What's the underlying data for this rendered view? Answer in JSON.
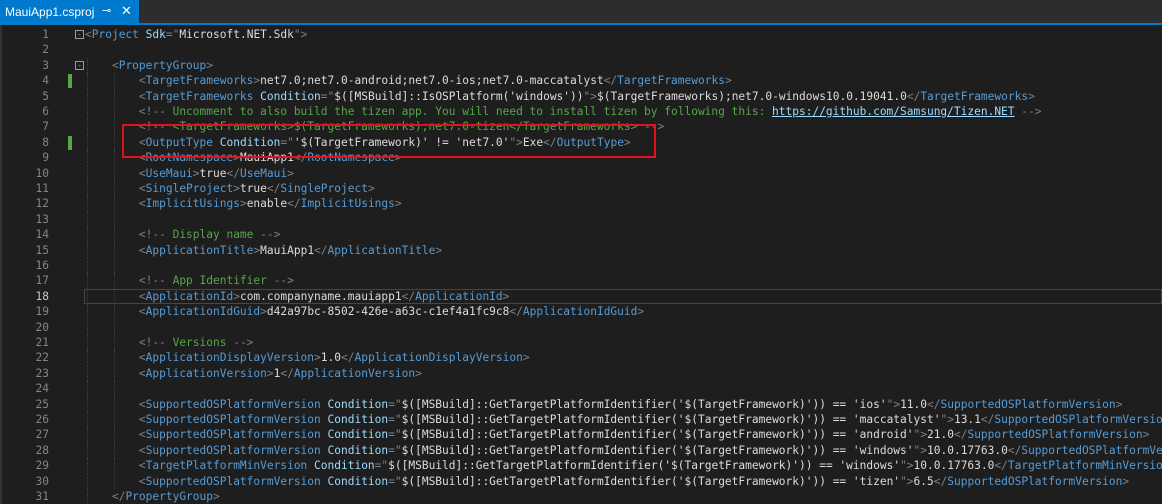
{
  "tab": {
    "title": "MauiApp1.csproj",
    "pin_icon": "⊸",
    "close_icon": "✕"
  },
  "lines": [
    {
      "n": "1",
      "fold": "-",
      "tokens": [
        {
          "t": "d",
          "s": "<"
        },
        {
          "t": "e",
          "s": "Project"
        },
        {
          "t": "x",
          "s": " "
        },
        {
          "t": "a",
          "s": "Sdk"
        },
        {
          "t": "d",
          "s": "=\""
        },
        {
          "t": "v",
          "s": "Microsoft.NET.Sdk"
        },
        {
          "t": "d",
          "s": "\">"
        }
      ]
    },
    {
      "n": "2",
      "tokens": []
    },
    {
      "n": "3",
      "fold": "-",
      "tokens": [
        {
          "t": "x",
          "s": "    "
        },
        {
          "t": "d",
          "s": "<"
        },
        {
          "t": "e",
          "s": "PropertyGroup"
        },
        {
          "t": "d",
          "s": ">"
        }
      ]
    },
    {
      "n": "4",
      "chg": true,
      "tokens": [
        {
          "t": "x",
          "s": "        "
        },
        {
          "t": "d",
          "s": "<"
        },
        {
          "t": "e",
          "s": "TargetFrameworks"
        },
        {
          "t": "d",
          "s": ">"
        },
        {
          "t": "t",
          "s": "net7.0;net7.0-android;net7.0-ios;net7.0-maccatalyst"
        },
        {
          "t": "d",
          "s": "</"
        },
        {
          "t": "e",
          "s": "TargetFrameworks"
        },
        {
          "t": "d",
          "s": ">"
        }
      ]
    },
    {
      "n": "5",
      "tokens": [
        {
          "t": "x",
          "s": "        "
        },
        {
          "t": "d",
          "s": "<"
        },
        {
          "t": "e",
          "s": "TargetFrameworks"
        },
        {
          "t": "x",
          "s": " "
        },
        {
          "t": "a",
          "s": "Condition"
        },
        {
          "t": "d",
          "s": "=\""
        },
        {
          "t": "v",
          "s": "$([MSBuild]::IsOSPlatform('windows'))"
        },
        {
          "t": "d",
          "s": "\">"
        },
        {
          "t": "t",
          "s": "$(TargetFrameworks);net7.0-windows10.0.19041.0"
        },
        {
          "t": "d",
          "s": "</"
        },
        {
          "t": "e",
          "s": "TargetFrameworks"
        },
        {
          "t": "d",
          "s": ">"
        }
      ]
    },
    {
      "n": "6",
      "tokens": [
        {
          "t": "x",
          "s": "        "
        },
        {
          "t": "d",
          "s": "<!--"
        },
        {
          "t": "c",
          "s": " Uncomment to also build the tizen app. You will need to install tizen by following this: "
        },
        {
          "t": "l",
          "s": "https://github.com/Samsung/Tizen.NET"
        },
        {
          "t": "c",
          "s": " "
        },
        {
          "t": "d",
          "s": "-->"
        }
      ]
    },
    {
      "n": "7",
      "tokens": [
        {
          "t": "x",
          "s": "        "
        },
        {
          "t": "d",
          "s": "<!--"
        },
        {
          "t": "c",
          "s": " <TargetFrameworks>$(TargetFrameworks);net7.0-tizen</TargetFrameworks> "
        },
        {
          "t": "d",
          "s": "-->"
        }
      ]
    },
    {
      "n": "8",
      "chg": true,
      "tokens": [
        {
          "t": "x",
          "s": "        "
        },
        {
          "t": "d",
          "s": "<"
        },
        {
          "t": "e",
          "s": "OutputType"
        },
        {
          "t": "x",
          "s": " "
        },
        {
          "t": "a",
          "s": "Condition"
        },
        {
          "t": "d",
          "s": "=\""
        },
        {
          "t": "v",
          "s": "'$(TargetFramework)' != 'net7.0'"
        },
        {
          "t": "d",
          "s": "\">"
        },
        {
          "t": "t",
          "s": "Exe"
        },
        {
          "t": "d",
          "s": "</"
        },
        {
          "t": "e",
          "s": "OutputType"
        },
        {
          "t": "d",
          "s": ">"
        }
      ]
    },
    {
      "n": "9",
      "tokens": [
        {
          "t": "x",
          "s": "        "
        },
        {
          "t": "d",
          "s": "<"
        },
        {
          "t": "e",
          "s": "RootNamespace"
        },
        {
          "t": "d",
          "s": ">"
        },
        {
          "t": "t",
          "s": "MauiApp1"
        },
        {
          "t": "d",
          "s": "</"
        },
        {
          "t": "e",
          "s": "RootNamespace"
        },
        {
          "t": "d",
          "s": ">"
        }
      ]
    },
    {
      "n": "10",
      "tokens": [
        {
          "t": "x",
          "s": "        "
        },
        {
          "t": "d",
          "s": "<"
        },
        {
          "t": "e",
          "s": "UseMaui"
        },
        {
          "t": "d",
          "s": ">"
        },
        {
          "t": "t",
          "s": "true"
        },
        {
          "t": "d",
          "s": "</"
        },
        {
          "t": "e",
          "s": "UseMaui"
        },
        {
          "t": "d",
          "s": ">"
        }
      ]
    },
    {
      "n": "11",
      "tokens": [
        {
          "t": "x",
          "s": "        "
        },
        {
          "t": "d",
          "s": "<"
        },
        {
          "t": "e",
          "s": "SingleProject"
        },
        {
          "t": "d",
          "s": ">"
        },
        {
          "t": "t",
          "s": "true"
        },
        {
          "t": "d",
          "s": "</"
        },
        {
          "t": "e",
          "s": "SingleProject"
        },
        {
          "t": "d",
          "s": ">"
        }
      ]
    },
    {
      "n": "12",
      "tokens": [
        {
          "t": "x",
          "s": "        "
        },
        {
          "t": "d",
          "s": "<"
        },
        {
          "t": "e",
          "s": "ImplicitUsings"
        },
        {
          "t": "d",
          "s": ">"
        },
        {
          "t": "t",
          "s": "enable"
        },
        {
          "t": "d",
          "s": "</"
        },
        {
          "t": "e",
          "s": "ImplicitUsings"
        },
        {
          "t": "d",
          "s": ">"
        }
      ]
    },
    {
      "n": "13",
      "tokens": []
    },
    {
      "n": "14",
      "tokens": [
        {
          "t": "x",
          "s": "        "
        },
        {
          "t": "d",
          "s": "<!--"
        },
        {
          "t": "c",
          "s": " Display name "
        },
        {
          "t": "d",
          "s": "-->"
        }
      ]
    },
    {
      "n": "15",
      "tokens": [
        {
          "t": "x",
          "s": "        "
        },
        {
          "t": "d",
          "s": "<"
        },
        {
          "t": "e",
          "s": "ApplicationTitle"
        },
        {
          "t": "d",
          "s": ">"
        },
        {
          "t": "t",
          "s": "MauiApp1"
        },
        {
          "t": "d",
          "s": "</"
        },
        {
          "t": "e",
          "s": "ApplicationTitle"
        },
        {
          "t": "d",
          "s": ">"
        }
      ]
    },
    {
      "n": "16",
      "tokens": []
    },
    {
      "n": "17",
      "tokens": [
        {
          "t": "x",
          "s": "        "
        },
        {
          "t": "d",
          "s": "<!--"
        },
        {
          "t": "c",
          "s": " App Identifier "
        },
        {
          "t": "d",
          "s": "-->"
        }
      ]
    },
    {
      "n": "18",
      "current": true,
      "tokens": [
        {
          "t": "x",
          "s": "        "
        },
        {
          "t": "d",
          "s": "<"
        },
        {
          "t": "e",
          "s": "ApplicationId"
        },
        {
          "t": "d",
          "s": ">"
        },
        {
          "t": "t",
          "s": "com.companyname.mauiapp1"
        },
        {
          "t": "d",
          "s": "</"
        },
        {
          "t": "e",
          "s": "ApplicationId"
        },
        {
          "t": "d",
          "s": ">"
        }
      ]
    },
    {
      "n": "19",
      "tokens": [
        {
          "t": "x",
          "s": "        "
        },
        {
          "t": "d",
          "s": "<"
        },
        {
          "t": "e",
          "s": "ApplicationIdGuid"
        },
        {
          "t": "d",
          "s": ">"
        },
        {
          "t": "t",
          "s": "d42a97bc-8502-426e-a63c-c1ef4a1fc9c8"
        },
        {
          "t": "d",
          "s": "</"
        },
        {
          "t": "e",
          "s": "ApplicationIdGuid"
        },
        {
          "t": "d",
          "s": ">"
        }
      ]
    },
    {
      "n": "20",
      "tokens": []
    },
    {
      "n": "21",
      "tokens": [
        {
          "t": "x",
          "s": "        "
        },
        {
          "t": "d",
          "s": "<!--"
        },
        {
          "t": "c",
          "s": " Versions "
        },
        {
          "t": "d",
          "s": "-->"
        }
      ]
    },
    {
      "n": "22",
      "tokens": [
        {
          "t": "x",
          "s": "        "
        },
        {
          "t": "d",
          "s": "<"
        },
        {
          "t": "e",
          "s": "ApplicationDisplayVersion"
        },
        {
          "t": "d",
          "s": ">"
        },
        {
          "t": "t",
          "s": "1.0"
        },
        {
          "t": "d",
          "s": "</"
        },
        {
          "t": "e",
          "s": "ApplicationDisplayVersion"
        },
        {
          "t": "d",
          "s": ">"
        }
      ]
    },
    {
      "n": "23",
      "tokens": [
        {
          "t": "x",
          "s": "        "
        },
        {
          "t": "d",
          "s": "<"
        },
        {
          "t": "e",
          "s": "ApplicationVersion"
        },
        {
          "t": "d",
          "s": ">"
        },
        {
          "t": "t",
          "s": "1"
        },
        {
          "t": "d",
          "s": "</"
        },
        {
          "t": "e",
          "s": "ApplicationVersion"
        },
        {
          "t": "d",
          "s": ">"
        }
      ]
    },
    {
      "n": "24",
      "tokens": []
    },
    {
      "n": "25",
      "tokens": [
        {
          "t": "x",
          "s": "        "
        },
        {
          "t": "d",
          "s": "<"
        },
        {
          "t": "e",
          "s": "SupportedOSPlatformVersion"
        },
        {
          "t": "x",
          "s": " "
        },
        {
          "t": "a",
          "s": "Condition"
        },
        {
          "t": "d",
          "s": "=\""
        },
        {
          "t": "v",
          "s": "$([MSBuild]::GetTargetPlatformIdentifier('$(TargetFramework)')) == 'ios'"
        },
        {
          "t": "d",
          "s": "\">"
        },
        {
          "t": "t",
          "s": "11.0"
        },
        {
          "t": "d",
          "s": "</"
        },
        {
          "t": "e",
          "s": "SupportedOSPlatformVersion"
        },
        {
          "t": "d",
          "s": ">"
        }
      ]
    },
    {
      "n": "26",
      "tokens": [
        {
          "t": "x",
          "s": "        "
        },
        {
          "t": "d",
          "s": "<"
        },
        {
          "t": "e",
          "s": "SupportedOSPlatformVersion"
        },
        {
          "t": "x",
          "s": " "
        },
        {
          "t": "a",
          "s": "Condition"
        },
        {
          "t": "d",
          "s": "=\""
        },
        {
          "t": "v",
          "s": "$([MSBuild]::GetTargetPlatformIdentifier('$(TargetFramework)')) == 'maccatalyst'"
        },
        {
          "t": "d",
          "s": "\">"
        },
        {
          "t": "t",
          "s": "13.1"
        },
        {
          "t": "d",
          "s": "</"
        },
        {
          "t": "e",
          "s": "SupportedOSPlatformVersion"
        },
        {
          "t": "d",
          "s": ">"
        }
      ]
    },
    {
      "n": "27",
      "tokens": [
        {
          "t": "x",
          "s": "        "
        },
        {
          "t": "d",
          "s": "<"
        },
        {
          "t": "e",
          "s": "SupportedOSPlatformVersion"
        },
        {
          "t": "x",
          "s": " "
        },
        {
          "t": "a",
          "s": "Condition"
        },
        {
          "t": "d",
          "s": "=\""
        },
        {
          "t": "v",
          "s": "$([MSBuild]::GetTargetPlatformIdentifier('$(TargetFramework)')) == 'android'"
        },
        {
          "t": "d",
          "s": "\">"
        },
        {
          "t": "t",
          "s": "21.0"
        },
        {
          "t": "d",
          "s": "</"
        },
        {
          "t": "e",
          "s": "SupportedOSPlatformVersion"
        },
        {
          "t": "d",
          "s": ">"
        }
      ]
    },
    {
      "n": "28",
      "tokens": [
        {
          "t": "x",
          "s": "        "
        },
        {
          "t": "d",
          "s": "<"
        },
        {
          "t": "e",
          "s": "SupportedOSPlatformVersion"
        },
        {
          "t": "x",
          "s": " "
        },
        {
          "t": "a",
          "s": "Condition"
        },
        {
          "t": "d",
          "s": "=\""
        },
        {
          "t": "v",
          "s": "$([MSBuild]::GetTargetPlatformIdentifier('$(TargetFramework)')) == 'windows'"
        },
        {
          "t": "d",
          "s": "\">"
        },
        {
          "t": "t",
          "s": "10.0.17763.0"
        },
        {
          "t": "d",
          "s": "</"
        },
        {
          "t": "e",
          "s": "SupportedOSPlatformVersion"
        },
        {
          "t": "d",
          "s": ">"
        }
      ]
    },
    {
      "n": "29",
      "tokens": [
        {
          "t": "x",
          "s": "        "
        },
        {
          "t": "d",
          "s": "<"
        },
        {
          "t": "e",
          "s": "TargetPlatformMinVersion"
        },
        {
          "t": "x",
          "s": " "
        },
        {
          "t": "a",
          "s": "Condition"
        },
        {
          "t": "d",
          "s": "=\""
        },
        {
          "t": "v",
          "s": "$([MSBuild]::GetTargetPlatformIdentifier('$(TargetFramework)')) == 'windows'"
        },
        {
          "t": "d",
          "s": "\">"
        },
        {
          "t": "t",
          "s": "10.0.17763.0"
        },
        {
          "t": "d",
          "s": "</"
        },
        {
          "t": "e",
          "s": "TargetPlatformMinVersion"
        },
        {
          "t": "d",
          "s": ">"
        }
      ]
    },
    {
      "n": "30",
      "tokens": [
        {
          "t": "x",
          "s": "        "
        },
        {
          "t": "d",
          "s": "<"
        },
        {
          "t": "e",
          "s": "SupportedOSPlatformVersion"
        },
        {
          "t": "x",
          "s": " "
        },
        {
          "t": "a",
          "s": "Condition"
        },
        {
          "t": "d",
          "s": "=\""
        },
        {
          "t": "v",
          "s": "$([MSBuild]::GetTargetPlatformIdentifier('$(TargetFramework)')) == 'tizen'"
        },
        {
          "t": "d",
          "s": "\">"
        },
        {
          "t": "t",
          "s": "6.5"
        },
        {
          "t": "d",
          "s": "</"
        },
        {
          "t": "e",
          "s": "SupportedOSPlatformVersion"
        },
        {
          "t": "d",
          "s": ">"
        }
      ]
    },
    {
      "n": "31",
      "tokens": [
        {
          "t": "x",
          "s": "    "
        },
        {
          "t": "d",
          "s": "</"
        },
        {
          "t": "e",
          "s": "PropertyGroup"
        },
        {
          "t": "d",
          "s": ">"
        }
      ]
    }
  ]
}
